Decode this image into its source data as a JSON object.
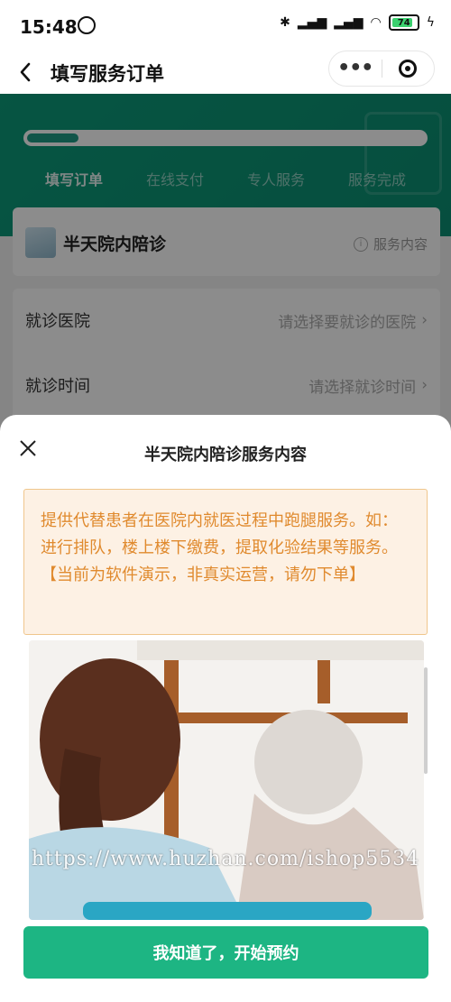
{
  "status_bar": {
    "time": "15:48",
    "battery": "74"
  },
  "nav": {
    "title": "填写服务订单"
  },
  "progress": {
    "value": 0.13
  },
  "steps": [
    "填写订单",
    "在线支付",
    "专人服务",
    "服务完成"
  ],
  "service": {
    "name": "半天院内陪诊",
    "info_label": "服务内容"
  },
  "form": {
    "hospital_label": "就诊医院",
    "hospital_placeholder": "请选择要就诊的医院",
    "time_label": "就诊时间",
    "time_placeholder": "请选择就诊时间"
  },
  "sheet": {
    "title": "半天院内陪诊服务内容",
    "notice": "提供代替患者在医院内就医过程中跑腿服务。如：进行排队，楼上楼下缴费，提取化验结果等服务。【当前为软件演示，非真实运营，请勿下单】",
    "watermark": "https://www.huzhan.com/ishop5534",
    "confirm_button": "我知道了，开始预约"
  },
  "colors": {
    "brand_green": "#0c9b79",
    "button_green": "#1db583",
    "notice_text": "#e08a2e",
    "notice_bg": "#fdf1e4"
  },
  "icons": [
    "alarm-icon",
    "bluetooth-icon",
    "signal-icon",
    "wifi-icon",
    "battery-icon",
    "charging-icon",
    "back-arrow-icon",
    "more-dots-icon",
    "capsule-close-icon",
    "info-icon",
    "chevron-right-icon",
    "close-icon"
  ]
}
